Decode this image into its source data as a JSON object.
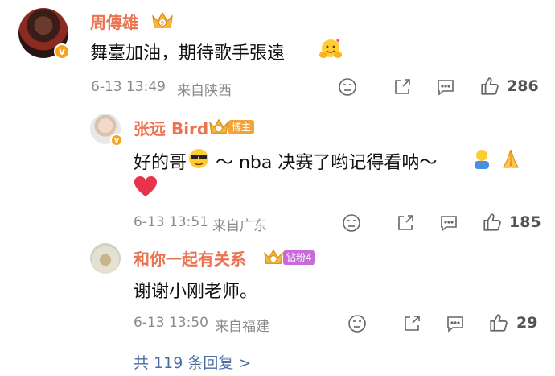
{
  "comments": [
    {
      "username": "周傳雄",
      "text": "舞臺加油，期待歌手張遠",
      "time": "6-13 13:49",
      "location": "来自陕西",
      "likes": "286"
    },
    {
      "username": "张远 Bird",
      "badge": "博主",
      "text_a": "好的哥",
      "text_b": "～ nba 决赛了哟记得看呐～",
      "time": "6-13 13:51",
      "location": "来自广东",
      "likes": "185"
    },
    {
      "username": "和你一起有关系",
      "badge": "钻粉4",
      "text": "谢谢小刚老师。",
      "time": "6-13 13:50",
      "location": "来自福建",
      "likes": "29"
    }
  ],
  "more_replies": "共 119 条回复 >",
  "icons": [
    "verified-icon",
    "crown-icon",
    "dislike-icon",
    "share-icon",
    "comment-icon",
    "like-icon"
  ],
  "colors": {
    "username": "#eb7350",
    "meta": "#8a8a8a",
    "link": "#4a6ea3",
    "verified": "#f7a21c"
  }
}
